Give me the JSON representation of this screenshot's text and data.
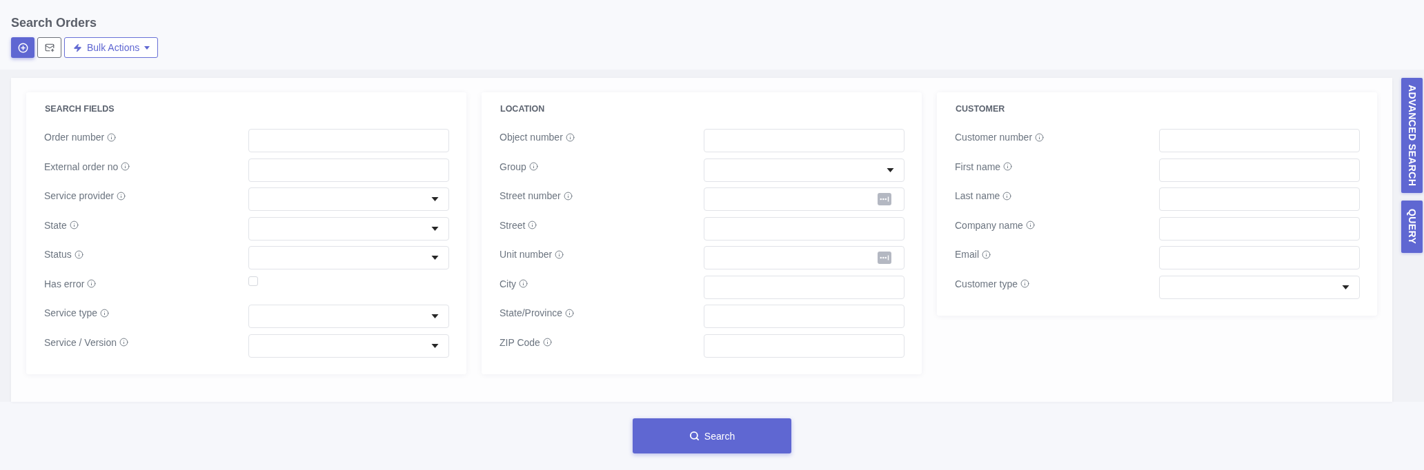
{
  "header": {
    "title": "Search Orders"
  },
  "toolbar": {
    "bulk_actions": {
      "label": "Bulk Actions"
    }
  },
  "sections": [
    {
      "title": "SEARCH FIELDS",
      "fields": [
        {
          "label": "Order number",
          "kind": "text"
        },
        {
          "label": "External order no",
          "kind": "text"
        },
        {
          "label": "Service provider",
          "kind": "select"
        },
        {
          "label": "State",
          "kind": "select"
        },
        {
          "label": "Status",
          "kind": "select"
        },
        {
          "label": "Has error",
          "kind": "checkbox",
          "checked": false
        },
        {
          "label": "Service type",
          "kind": "select"
        },
        {
          "label": "Service / Version",
          "kind": "select"
        }
      ]
    },
    {
      "title": "LOCATION",
      "fields": [
        {
          "label": "Object number",
          "kind": "text"
        },
        {
          "label": "Group",
          "kind": "select"
        },
        {
          "label": "Street number",
          "kind": "lookup"
        },
        {
          "label": "Street",
          "kind": "text"
        },
        {
          "label": "Unit number",
          "kind": "lookup"
        },
        {
          "label": "City",
          "kind": "text"
        },
        {
          "label": "State/Province",
          "kind": "text"
        },
        {
          "label": "ZIP Code",
          "kind": "text"
        }
      ]
    },
    {
      "title": "CUSTOMER",
      "fields": [
        {
          "label": "Customer number",
          "kind": "text"
        },
        {
          "label": "First name",
          "kind": "text"
        },
        {
          "label": "Last name",
          "kind": "text"
        },
        {
          "label": "Company name",
          "kind": "text"
        },
        {
          "label": "Email",
          "kind": "text"
        },
        {
          "label": "Customer type",
          "kind": "select"
        }
      ]
    }
  ],
  "side_tabs": [
    {
      "label": "ADVANCED SEARCH"
    },
    {
      "label": "QUERY"
    }
  ],
  "search_button": {
    "label": "Search"
  }
}
